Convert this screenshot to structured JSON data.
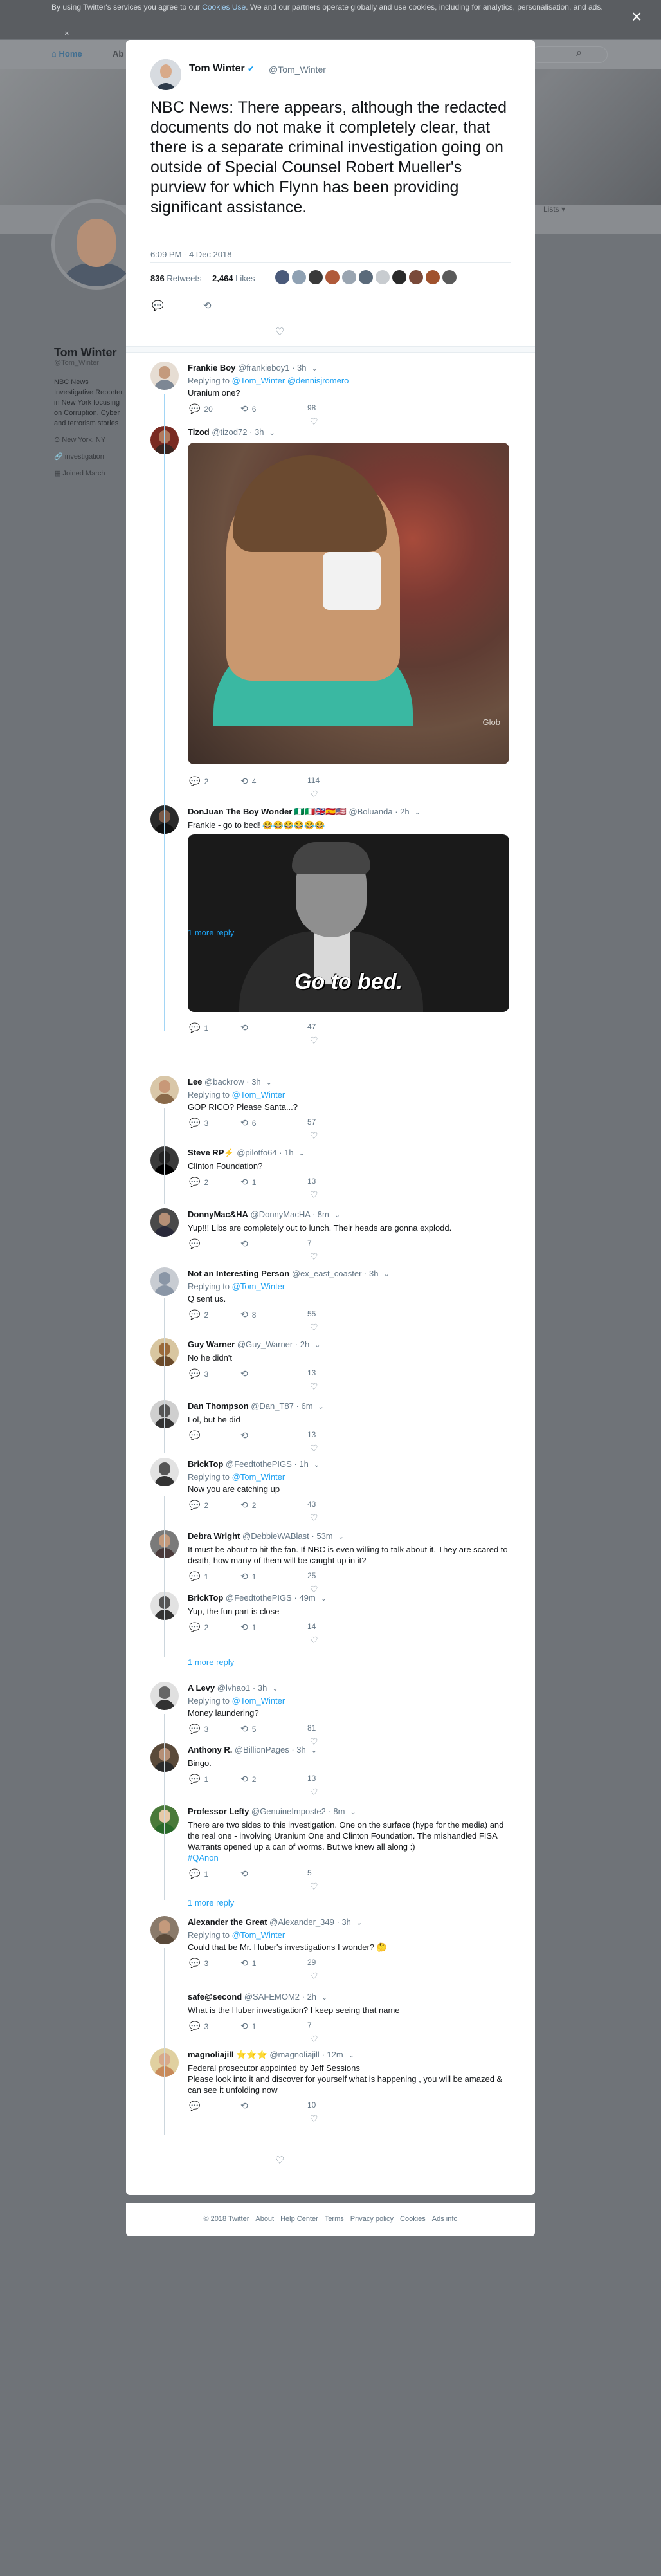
{
  "cookie": {
    "line1_a": "By using Twitter's services you agree to our ",
    "link": "Cookies Use",
    "line1_b": ". We and our partners operate globally and use cookies, including for analytics, personalisation, and ads.",
    "close": "×"
  },
  "background": {
    "nav_home": "Home",
    "nav_about": "Ab",
    "stat": "Lists ▾",
    "name": "Tom Winter",
    "handle": "@Tom_Winter",
    "bio": "NBC News Investigative Reporter in New York focusing on Corruption, Cyber and terrorism stories",
    "location": "New York, NY",
    "link": "investigation",
    "joined": "Joined March"
  },
  "modal_close": "×",
  "tweet": {
    "name": "Tom Winter",
    "handle": "@Tom_Winter",
    "text": "NBC News: There appears, although the redacted documents do not make it completely clear, that there is a separate criminal investigation going on outside of Special Counsel Robert Mueller's purview for which Flynn has been providing significant assistance.",
    "time": "6:09 PM - 4 Dec 2018",
    "retweets": "836",
    "retweets_label": "Retweets",
    "likes": "2,464",
    "likes_label": "Likes",
    "liker_colors": [
      "#4a5a7a",
      "#8fa1b3",
      "#3a3a3a",
      "#b05a3a",
      "#9aa5b1",
      "#5a6a7a",
      "#c8ccd0",
      "#2a2a2a",
      "#7a4a3a",
      "#a0522d",
      "#5a5a5a"
    ]
  },
  "replies": [
    {
      "name": "Frankie Boy",
      "handle": "@frankieboy1",
      "time": "· 3h",
      "replying": "Replying to",
      "to": "@Tom_Winter @dennisjromero",
      "text": "Uranium one?",
      "replies": "20",
      "retweets": "6",
      "likes": "98"
    },
    {
      "name": "Tizod",
      "handle": "@tizod72",
      "time": "· 3h",
      "text": "",
      "gif_watermark": "Glob",
      "replies": "2",
      "retweets": "4",
      "likes": "114"
    },
    {
      "name": "DonJuan The Boy Wonder 🇳🇬🇮🇹🇬🇧🇪🇸🇺🇸",
      "handle": "@Boluanda",
      "time": "· 2h",
      "text": "Frankie - go to bed! 😂😂😂😂😂😂",
      "gif_caption": "Go to bed.",
      "replies": "1",
      "retweets": "",
      "likes": "47",
      "more": "1 more reply"
    },
    {
      "name": "Lee",
      "handle": "@backrow",
      "time": "· 3h",
      "replying": "Replying to",
      "to": "@Tom_Winter",
      "text": "GOP RICO? Please Santa...?",
      "replies": "3",
      "retweets": "6",
      "likes": "57"
    },
    {
      "name": "Steve RP⚡",
      "handle": "@pilotfo64",
      "time": "· 1h",
      "text": "Clinton Foundation?",
      "replies": "2",
      "retweets": "1",
      "likes": "13"
    },
    {
      "name": "DonnyMac&HA",
      "handle": "@DonnyMacHA",
      "time": "· 8m",
      "text": "Yup!!! Libs are completely out to lunch.  Their heads are gonna explodd.",
      "replies": "",
      "retweets": "",
      "likes": "7"
    },
    {
      "name": "Not an Interesting Person",
      "handle": "@ex_east_coaster",
      "time": "· 3h",
      "replying": "Replying to",
      "to": "@Tom_Winter",
      "text": "Q sent us.",
      "replies": "2",
      "retweets": "8",
      "likes": "55"
    },
    {
      "name": "Guy Warner",
      "handle": "@Guy_Warner",
      "time": "· 2h",
      "text": "No he didn't",
      "replies": "3",
      "retweets": "",
      "likes": "13"
    },
    {
      "name": "Dan Thompson",
      "handle": "@Dan_T87",
      "time": "· 6m",
      "text": "Lol, but he did",
      "replies": "",
      "retweets": "",
      "likes": "13"
    },
    {
      "name": "BrickTop",
      "handle": "@FeedtothePIGS",
      "time": "· 1h",
      "replying": "Replying to",
      "to": "@Tom_Winter",
      "text": "Now you are catching up",
      "replies": "2",
      "retweets": "2",
      "likes": "43"
    },
    {
      "name": "Debra Wright",
      "handle": "@DebbieWABlast",
      "time": "· 53m",
      "text": "It must be about to hit the fan. If NBC is even willing to talk about it. They are scared to death, how many of them will be caught up in it?",
      "replies": "1",
      "retweets": "1",
      "likes": "25"
    },
    {
      "name": "BrickTop",
      "handle": "@FeedtothePIGS",
      "time": "· 49m",
      "text": "Yup, the fun part is close",
      "replies": "2",
      "retweets": "1",
      "likes": "14",
      "more": "1 more reply"
    },
    {
      "name": "A Levy",
      "handle": "@lvhao1",
      "time": "· 3h",
      "replying": "Replying to",
      "to": "@Tom_Winter",
      "text": "Money laundering?",
      "replies": "3",
      "retweets": "5",
      "likes": "81"
    },
    {
      "name": "Anthony R.",
      "handle": "@BillionPages",
      "time": "· 3h",
      "text": "Bingo.",
      "replies": "1",
      "retweets": "2",
      "likes": "13"
    },
    {
      "name": "Professor Lefty",
      "handle": "@GenuineImposte2",
      "time": "· 8m",
      "text": "There are two sides to this investigation. One on the surface (hype for the media) and the real one - involving Uranium One and Clinton Foundation. The mishandled FISA Warrants opened up a can of worms.  But we knew all along :)",
      "hashtag": "#QAnon",
      "replies": "1",
      "retweets": "",
      "likes": "5",
      "more": "1 more reply"
    },
    {
      "name": "Alexander the Great",
      "handle": "@Alexander_349",
      "time": "· 3h",
      "replying": "Replying to",
      "to": "@Tom_Winter",
      "text": "Could that be Mr. Huber's investigations I wonder? 🤔",
      "replies": "3",
      "retweets": "1",
      "likes": "29"
    },
    {
      "name": "safe@second",
      "handle": "@SAFEMOM2",
      "time": "· 2h",
      "text": "What is the Huber investigation? I keep seeing that name",
      "replies": "3",
      "retweets": "1",
      "likes": "7"
    },
    {
      "name": "magnoliajill ⭐⭐⭐",
      "handle": "@magnoliajill",
      "time": "· 12m",
      "text": "Federal prosecutor appointed by Jeff Sessions\nPlease look into it and discover for yourself what is happening , you will be amazed & can see it unfolding now",
      "replies": "",
      "retweets": "",
      "likes": "10"
    }
  ],
  "footer": {
    "items": [
      "© 2018 Twitter",
      "About",
      "Help Center",
      "Terms",
      "Privacy policy",
      "Cookies",
      "Ads info"
    ]
  },
  "icons": {
    "reply": "💬",
    "retweet": "⟲",
    "like": "♡",
    "chevron": "⌄",
    "search": "⌕",
    "home": "⌂",
    "location": "⊙",
    "link": "🔗",
    "calendar": "▦",
    "verified": "✔"
  }
}
